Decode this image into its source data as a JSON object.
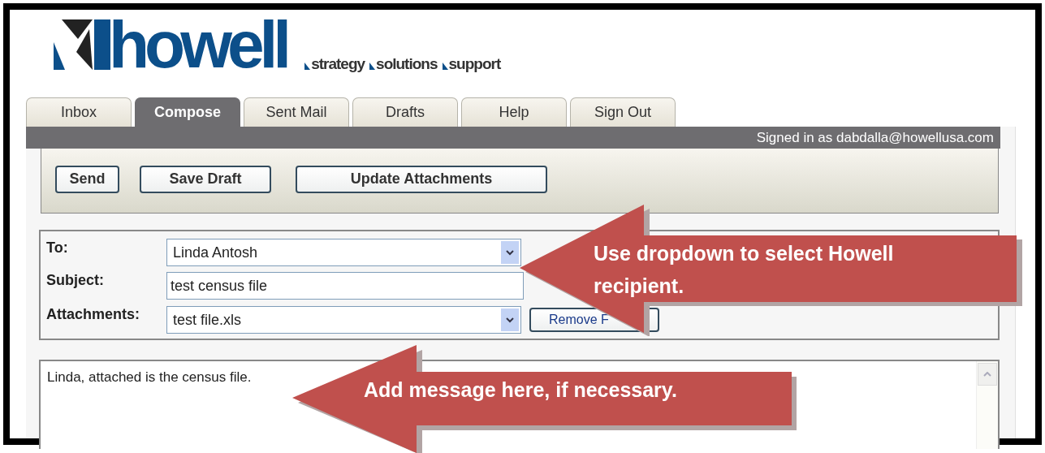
{
  "logo": {
    "name": "howell",
    "tagline": [
      "strategy",
      "solutions",
      "support"
    ]
  },
  "tabs": [
    {
      "label": "Inbox",
      "selected": false
    },
    {
      "label": "Compose",
      "selected": true
    },
    {
      "label": "Sent Mail",
      "selected": false
    },
    {
      "label": "Drafts",
      "selected": false
    },
    {
      "label": "Help",
      "selected": false
    },
    {
      "label": "Sign Out",
      "selected": false
    }
  ],
  "signed_in": "Signed in as dabdalla@howellusa.com",
  "toolbar": [
    "Send",
    "Save Draft",
    "Update Attachments"
  ],
  "form": {
    "to": {
      "label": "To:",
      "value": "Linda Antosh"
    },
    "subject": {
      "label": "Subject:",
      "value": "test census file"
    },
    "attachments": {
      "label": "Attachments:",
      "value": "test file.xls",
      "button": "Remove F"
    }
  },
  "message": "Linda, attached is the census file.",
  "callouts": [
    {
      "text": "Use dropdown to select Howell recipient."
    },
    {
      "text": "Add message here, if necessary."
    }
  ]
}
